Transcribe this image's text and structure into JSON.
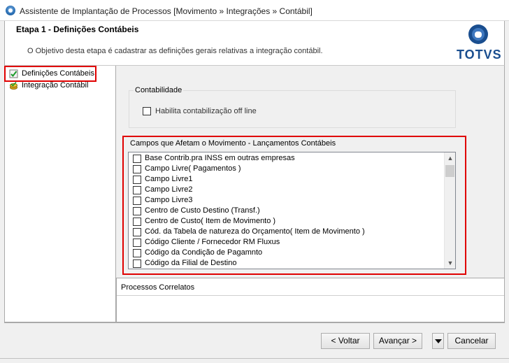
{
  "window": {
    "title": "Assistente de Implantação de Processos [Movimento » Integrações » Contábil]"
  },
  "header": {
    "step_title": "Etapa 1 - Definições Contábeis",
    "step_description": "O Objetivo desta etapa é cadastrar as definições gerais relativas a integração contábil.",
    "logo_text": "TOTVS"
  },
  "nav": {
    "items": [
      {
        "label": "Definições Contábeis",
        "icon": "check-document-icon",
        "selected": true
      },
      {
        "label": "Integração Contábil",
        "icon": "coins-icon",
        "selected": false
      }
    ]
  },
  "contabilidade": {
    "legend": "Contabilidade",
    "offline_label": "Habilita contabilização off line",
    "offline_checked": false
  },
  "campos": {
    "legend": "Campos que Afetam o Movimento - Lançamentos Contábeis",
    "items": [
      "Base Contrib.pra INSS em outras empresas",
      "Campo Livre( Pagamentos )",
      "Campo Livre1",
      "Campo Livre2",
      "Campo Livre3",
      "Centro de Custo Destino (Transf.)",
      "Centro de Custo( Item de Movimento )",
      "Cód. da Tabela de natureza do Orçamento( Item de Movimento )",
      "Código Cliente / Fornecedor RM Fluxus",
      "Código da Condição de Pagamnto",
      "Código da Filial de Destino"
    ]
  },
  "related": {
    "title": "Processos Correlatos"
  },
  "buttons": {
    "back": "< Voltar",
    "next": "Avançar >",
    "cancel": "Cancelar"
  },
  "colors": {
    "highlight": "#e00000",
    "logo_blue": "#1a4e8f"
  }
}
